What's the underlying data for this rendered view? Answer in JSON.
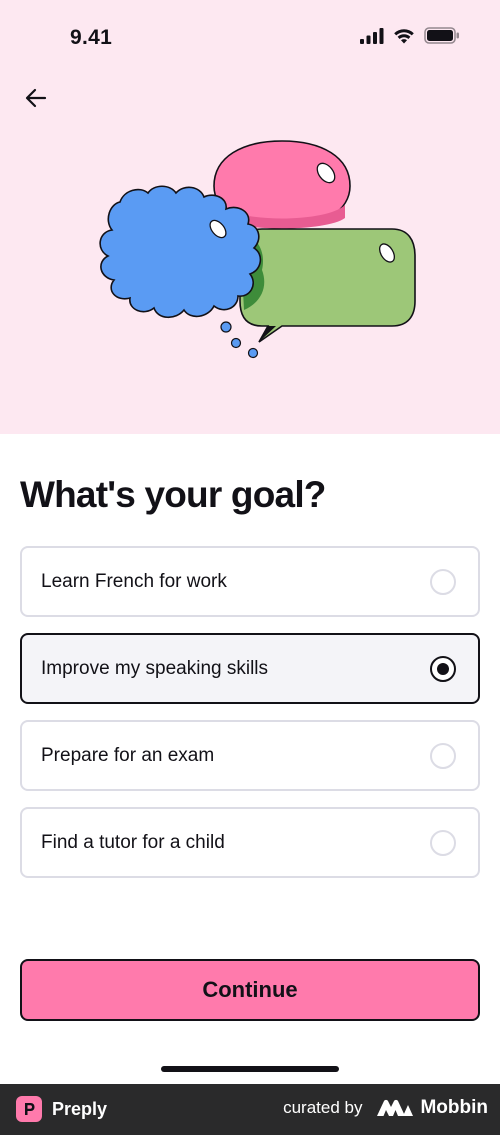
{
  "status_bar": {
    "time": "9.41",
    "icons": [
      "signal-icon",
      "wifi-icon",
      "battery-icon"
    ]
  },
  "header": {
    "back_icon": "arrow-left-icon"
  },
  "illustration": {
    "icon": "speech-bubbles-illustration"
  },
  "main": {
    "title": "What's your goal?",
    "options": [
      {
        "label": "Learn French for work",
        "selected": false
      },
      {
        "label": "Improve my speaking skills",
        "selected": true
      },
      {
        "label": "Prepare for an exam",
        "selected": false
      },
      {
        "label": "Find a tutor for a child",
        "selected": false
      }
    ],
    "continue_label": "Continue"
  },
  "footer": {
    "app_name": "Preply",
    "curated_by": "curated by",
    "curator_name": "Mobbin"
  },
  "colors": {
    "hero_background": "#fde8f1",
    "accent_pink": "#ff7aac",
    "text_primary": "#121117",
    "option_border": "#dcdce5",
    "selected_background": "#f4f4f8",
    "footer_background": "#2a2a2b"
  }
}
